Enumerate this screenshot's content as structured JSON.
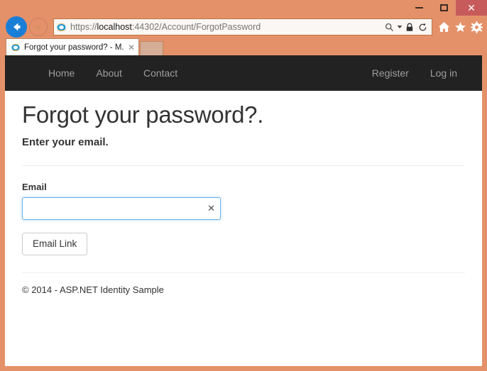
{
  "browser": {
    "window_controls": {
      "minimize_label": "minimize",
      "maximize_label": "maximize",
      "close_label": "✕"
    },
    "address": {
      "scheme": "https://",
      "host": "localhost",
      "path": ":44302/Account/ForgotPassword",
      "full_url": "https://localhost:44302/Account/ForgotPassword"
    },
    "toolbar_icons": [
      "search-icon",
      "dropdown-arrow-icon",
      "lock-icon",
      "refresh-icon",
      "home-icon",
      "favorites-star-icon",
      "settings-gear-icon"
    ],
    "tab": {
      "title": "Forgot your password? - M...",
      "close_label": "✕"
    },
    "new_tab_label": ""
  },
  "site_nav": {
    "left_links": [
      {
        "label": "Home"
      },
      {
        "label": "About"
      },
      {
        "label": "Contact"
      }
    ],
    "right_links": [
      {
        "label": "Register"
      },
      {
        "label": "Log in"
      }
    ]
  },
  "page": {
    "title": "Forgot your password?.",
    "subtitle": "Enter your email.",
    "form": {
      "email_label": "Email",
      "email_value": "",
      "email_placeholder": "",
      "clear_icon_label": "✕",
      "submit_label": "Email Link"
    },
    "footer": "© 2014 - ASP.NET Identity Sample"
  },
  "colors": {
    "window_frame": "#e4916a",
    "close_button": "#c75b5b",
    "navbar": "#222222",
    "nav_link": "#9d9d9d",
    "focus_border": "#66afe9",
    "back_button": "#1a7ed6"
  }
}
